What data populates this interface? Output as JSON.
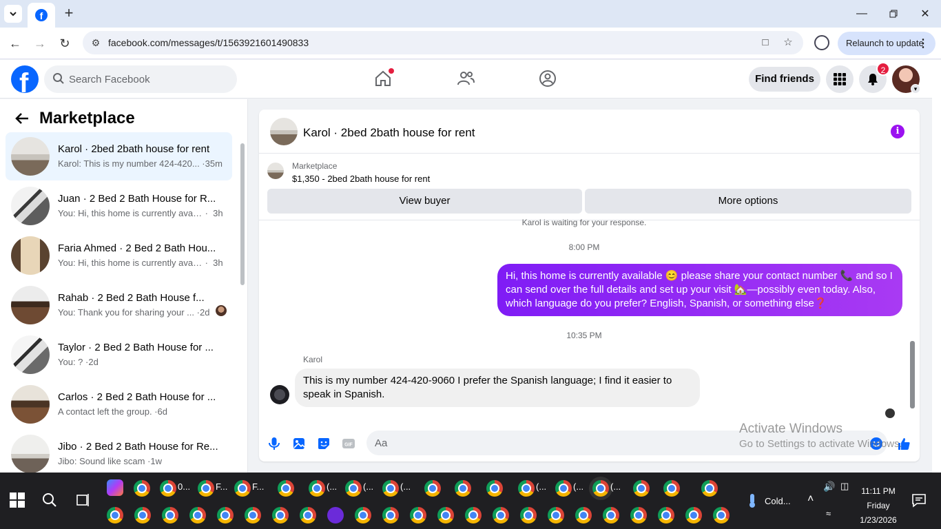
{
  "browser": {
    "url": "facebook.com/messages/t/1563921601490833",
    "relaunch_label": "Relaunch to update"
  },
  "header": {
    "search_placeholder": "Search Facebook",
    "find_friends_label": "Find friends",
    "notification_count": "2",
    "logo_letter": "f"
  },
  "sidebar": {
    "title": "Marketplace",
    "conversations": [
      {
        "name": "Karol · 2bed 2bath house for rent",
        "snippet": "Karol: This is my number 424-420...",
        "time": "35m"
      },
      {
        "name": "Juan · 2 Bed 2 Bath House for R...",
        "snippet": "You: Hi, this home is currently avail...",
        "time": "3h"
      },
      {
        "name": "Faria Ahmed · 2 Bed 2 Bath Hou...",
        "snippet": "You: Hi, this home is currently avail...",
        "time": "3h"
      },
      {
        "name": "Rahab · 2 Bed 2 Bath House f...",
        "snippet": "You: Thank you for sharing your ...",
        "time": "2d"
      },
      {
        "name": "Taylor · 2 Bed 2 Bath House for ...",
        "snippet": "You: ?",
        "time": "2d"
      },
      {
        "name": "Carlos · 2 Bed 2 Bath House for ...",
        "snippet": "A contact left the group.",
        "time": "6d"
      },
      {
        "name": "Jibo · 2 Bed 2 Bath House for Re...",
        "snippet": "Jibo: Sound like scam",
        "time": "1w"
      }
    ]
  },
  "chat": {
    "title": "Karol · 2bed 2bath house for rent",
    "marketplace_label": "Marketplace",
    "listing": "$1,350 - 2bed 2bath house for rent",
    "view_buyer_label": "View buyer",
    "more_options_label": "More options",
    "waiting_text": "Karol is waiting for your response.",
    "time_1": "8:00 PM",
    "outgoing_message": "Hi, this home is currently available 😊 please share your contact number 📞 and  so I can send over the full details and set up your visit 🏡—possibly even today. Also, which language do you prefer? English, Spanish, or something else❓",
    "time_2": "10:35 PM",
    "incoming_sender": "Karol",
    "incoming_message": "This is my number 424-420-9060 I prefer the Spanish language; I find it easier to speak in Spanish.",
    "composer_placeholder": "Aa"
  },
  "watermark": {
    "line1": "Activate Windows",
    "line2": "Go to Settings to activate Windows."
  },
  "taskbar": {
    "labels_top": [
      "0...",
      "F...",
      "F...",
      "(...",
      "(...",
      "(...",
      "(...",
      "(...",
      "(..."
    ],
    "weather": "Cold...",
    "time": "11:11 PM",
    "day": "Friday",
    "date": "1/23/2026"
  },
  "colors": {
    "fb_blue": "#0866ff",
    "messenger_purple": "#9b11f0",
    "badge_red": "#e41e3f"
  }
}
